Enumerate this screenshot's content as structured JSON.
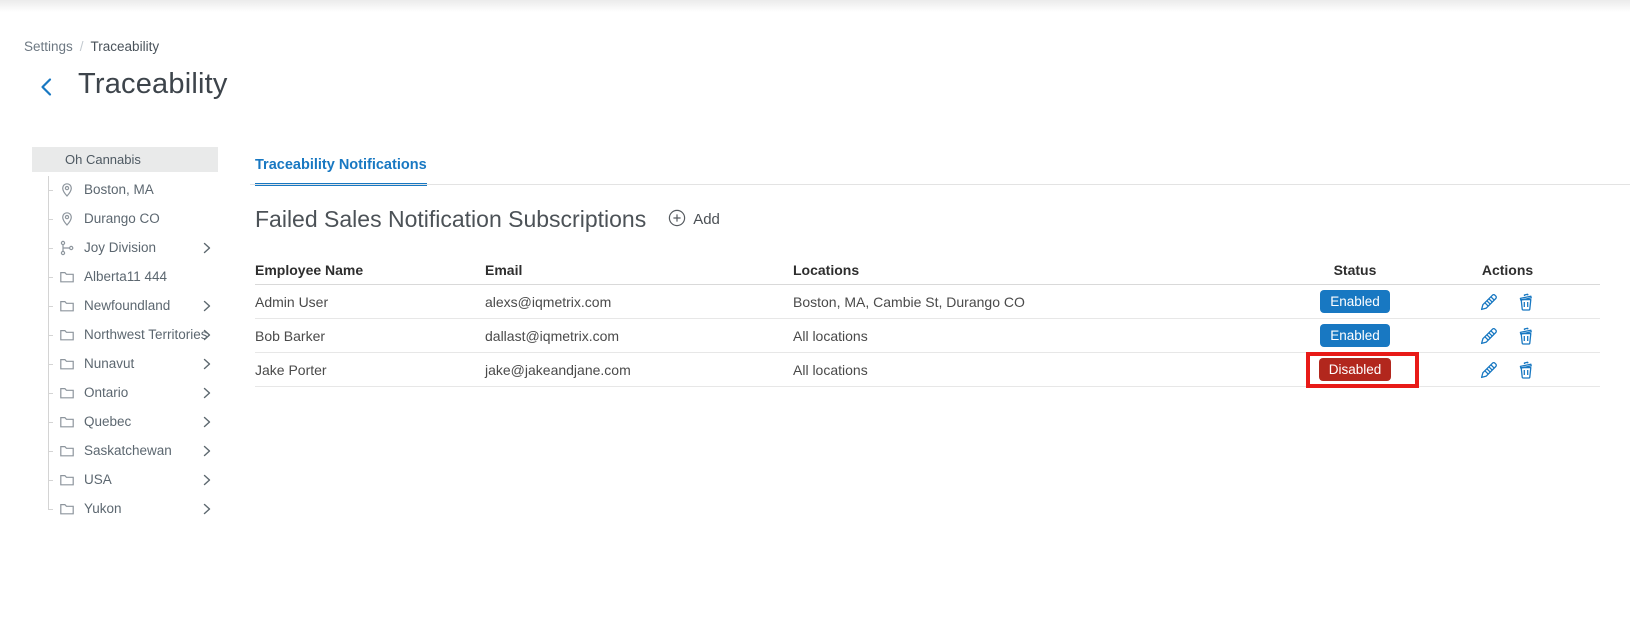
{
  "breadcrumb": {
    "items": [
      "Settings",
      "Traceability"
    ],
    "separator": "/"
  },
  "page": {
    "title": "Traceability"
  },
  "sidebar": {
    "root_label": "Oh Cannabis",
    "items": [
      {
        "label": "Boston, MA",
        "icon": "map-pin",
        "chevron": false
      },
      {
        "label": "Durango CO",
        "icon": "map-pin",
        "chevron": false
      },
      {
        "label": "Joy Division",
        "icon": "branch",
        "chevron": true
      },
      {
        "label": "Alberta11 444",
        "icon": "folder",
        "chevron": false
      },
      {
        "label": "Newfoundland",
        "icon": "folder",
        "chevron": true
      },
      {
        "label": "Northwest Territories",
        "icon": "folder",
        "chevron": true
      },
      {
        "label": "Nunavut",
        "icon": "folder",
        "chevron": true
      },
      {
        "label": "Ontario",
        "icon": "folder",
        "chevron": true
      },
      {
        "label": "Quebec",
        "icon": "folder",
        "chevron": true
      },
      {
        "label": "Saskatchewan",
        "icon": "folder",
        "chevron": true
      },
      {
        "label": "USA",
        "icon": "folder",
        "chevron": true
      },
      {
        "label": "Yukon",
        "icon": "folder",
        "chevron": true
      }
    ]
  },
  "tabs": {
    "items": [
      {
        "label": "Traceability Notifications",
        "active": true
      }
    ]
  },
  "section": {
    "title": "Failed Sales Notification Subscriptions",
    "add_label": "Add"
  },
  "table": {
    "headers": {
      "employee": "Employee Name",
      "email": "Email",
      "locations": "Locations",
      "status": "Status",
      "actions": "Actions"
    },
    "rows": [
      {
        "employee": "Admin User",
        "email": "alexs@iqmetrix.com",
        "locations": "Boston, MA, Cambie St, Durango CO",
        "status": "Enabled",
        "highlighted": false
      },
      {
        "employee": "Bob Barker",
        "email": "dallast@iqmetrix.com",
        "locations": "All locations",
        "status": "Enabled",
        "highlighted": false
      },
      {
        "employee": "Jake Porter",
        "email": "jake@jakeandjane.com",
        "locations": "All locations",
        "status": "Disabled",
        "highlighted": true
      }
    ]
  },
  "colors": {
    "accent_blue": "#1878c2",
    "enabled_badge_bg": "#1878c2",
    "disabled_badge_bg": "#b2271d",
    "annotation_red": "#e81a17"
  }
}
